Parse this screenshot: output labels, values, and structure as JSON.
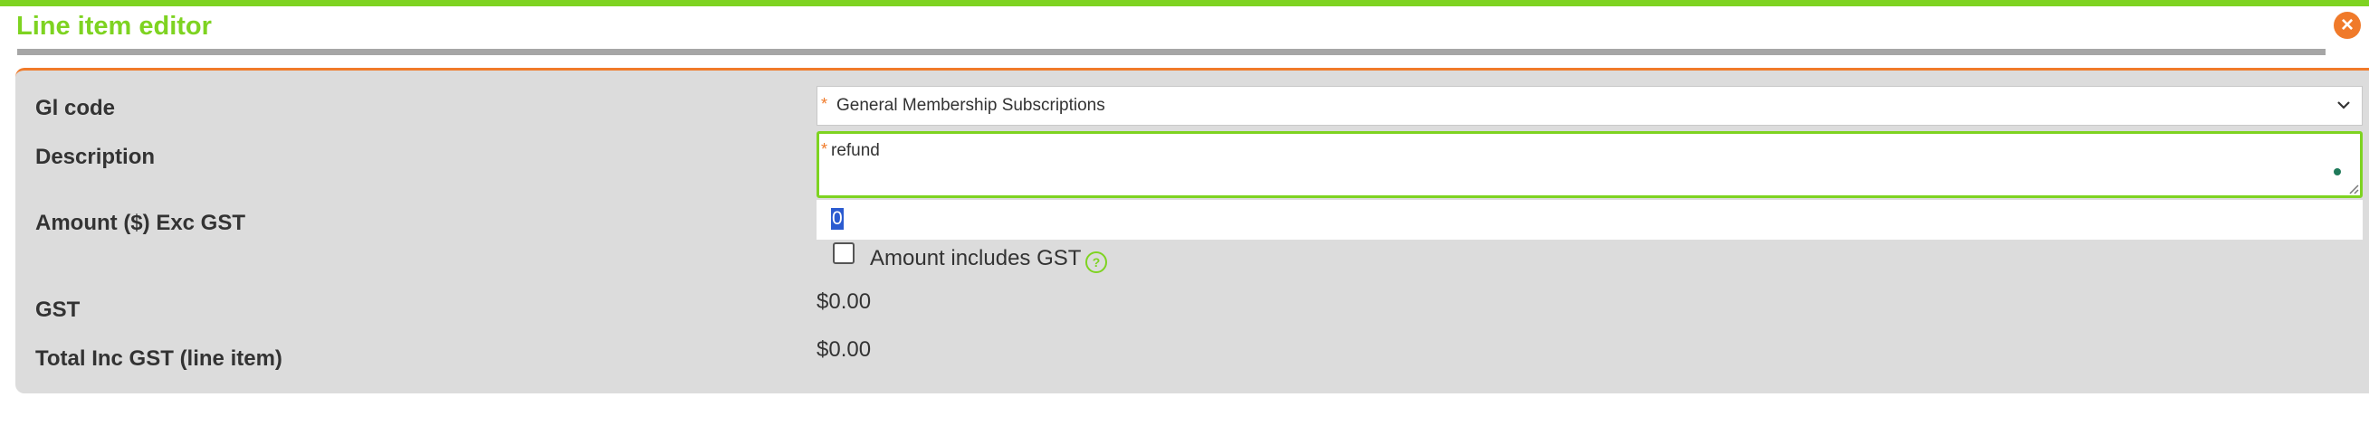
{
  "dialog": {
    "title": "Line item editor",
    "close_icon": "close-icon"
  },
  "form": {
    "gl_code": {
      "label": "Gl code",
      "required_mark": "*",
      "selected": "General Membership Subscriptions"
    },
    "description": {
      "label": "Description",
      "required_mark": "*",
      "value": "refund"
    },
    "amount": {
      "label": "Amount ($) Exc GST",
      "value": "0"
    },
    "includes_gst": {
      "label": "Amount includes GST",
      "checked": false,
      "help_icon": "help-icon",
      "help_glyph": "?"
    },
    "gst": {
      "label": "GST",
      "value": "$0.00"
    },
    "total": {
      "label": "Total Inc GST (line item)",
      "value": "$0.00"
    }
  },
  "colors": {
    "accent_green": "#7ed321",
    "accent_orange": "#f07a2a",
    "panel_bg": "#dcdcdc"
  }
}
